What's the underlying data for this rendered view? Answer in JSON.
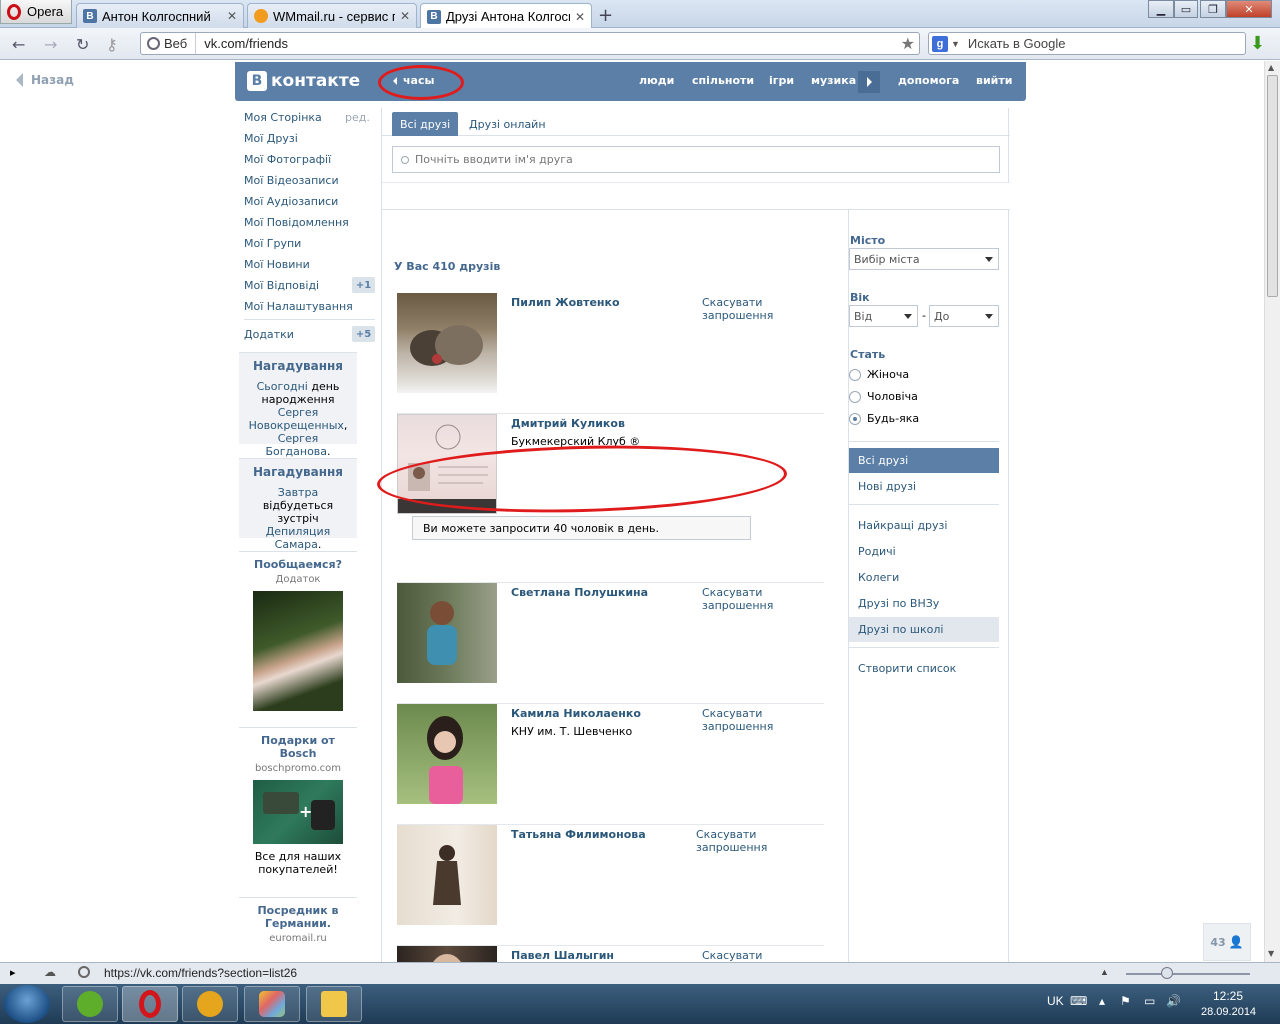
{
  "browser": {
    "menu_label": "Opera",
    "tabs": [
      {
        "title": "Антон Колгоспний",
        "favicon": "vk-icon",
        "active": false
      },
      {
        "title": "WMmail.ru - сервис п...",
        "favicon": "wmmail-icon",
        "active": false
      },
      {
        "title": "Друзі Антона Колгосп...",
        "favicon": "vk-icon",
        "active": true
      }
    ],
    "address_prefix": "Веб",
    "url": "vk.com/friends",
    "search_engine": "Google",
    "search_placeholder": "Искать в Google",
    "status_url": "https://vk.com/friends?section=list26"
  },
  "page": {
    "back_label": "Назад",
    "header": {
      "logo_letter": "В",
      "logo_text": "контакте",
      "clock_label": "часы",
      "nav": [
        "люди",
        "спільноти",
        "ігри",
        "музика",
        "допомога",
        "вийти"
      ]
    },
    "left_menu": {
      "edit_label": "ред.",
      "items": [
        "Моя Сторінка",
        "Мої Друзі",
        "Мої Фотографії",
        "Мої Відеозаписи",
        "Мої Аудіозаписи",
        "Мої Повідомлення",
        "Мої Групи",
        "Мої Новини",
        "Мої Відповіді",
        "Мої Налаштування"
      ],
      "replies_badge": "+1",
      "apps_label": "Додатки",
      "apps_badge": "+5"
    },
    "reminders": [
      {
        "title": "Нагадування",
        "link1": "Сьогодні",
        "text1": " день народження ",
        "link2": "Сергея Новокрещенных",
        "text2": ", ",
        "link3": "Сергея Богданова",
        "text3": "."
      },
      {
        "title": "Нагадування",
        "link1": "Завтра",
        "text1": " відбудеться зустріч ",
        "link2": "Депиляция Самара",
        "text2": "."
      }
    ],
    "ads": [
      {
        "title": "Пообщаемся?",
        "sub": "Додаток",
        "desc": ""
      },
      {
        "title": "Подарки от Bosch",
        "sub": "boschpromo.com",
        "desc": "Все для наших покупателей!"
      },
      {
        "title": "Посредник в Германии.",
        "sub": "euromail.ru",
        "desc": ""
      }
    ],
    "friend_tabs": [
      "Всі друзі",
      "Друзі онлайн"
    ],
    "search_placeholder": "Почніть вводити ім'я друга",
    "summary": "У Вас 410 друзів",
    "friends": [
      {
        "name": "Пилип Жовтенко",
        "sub": "",
        "action": "Скасувати запрошення"
      },
      {
        "name": "Дмитрий Куликов",
        "sub": "Букмекерский Клуб ®",
        "action": ""
      },
      {
        "name": "Светлана Полушкина",
        "sub": "",
        "action": "Скасувати запрошення"
      },
      {
        "name": "Камила Николаенко",
        "sub": "КНУ им. Т. Шевченко",
        "action": "Скасувати запрошення"
      },
      {
        "name": "Татьяна Филимонова",
        "sub": "",
        "action": "Скасувати запрошення"
      },
      {
        "name": "Павел Шалыгин",
        "sub": "",
        "action": "Скасувати запрошення"
      }
    ],
    "invite_notice": "Ви можете запросити 40 чоловік в день.",
    "filters": {
      "city_label": "Місто",
      "city_placeholder": "Вибір міста",
      "age_label": "Вік",
      "age_from": "Від",
      "age_dash": "-",
      "age_to": "До",
      "gender_label": "Стать",
      "genders": [
        "Жіноча",
        "Чоловіча",
        "Будь-яка"
      ],
      "gender_selected": "Будь-яка",
      "sections": [
        "Всі друзі",
        "Нові друзі",
        "Найкращі друзі",
        "Родичі",
        "Колеги",
        "Друзі по ВНЗу",
        "Друзі по школі"
      ],
      "create_list": "Створити список"
    },
    "online_counter": "43"
  },
  "taskbar": {
    "language": "UK",
    "time": "12:25",
    "date": "28.09.2014",
    "apps": [
      "utorrent-icon",
      "opera-icon",
      "aimp-icon",
      "paint-icon",
      "explorer-icon"
    ]
  },
  "colors": {
    "vk_blue": "#5b7fa6",
    "link": "#2b587a",
    "annotation": "#e01b1b"
  }
}
